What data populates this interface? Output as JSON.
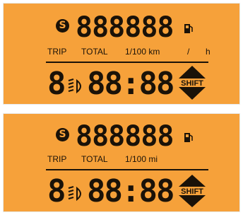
{
  "top_panel": {
    "service_icon": "wrench-service-icon",
    "service_glyph": "S",
    "odometer": "888888",
    "fuel_icon": "fuel-pump-icon",
    "trip": "TRIP",
    "total": "TOTAL",
    "units": "1/100 km",
    "slash": "/",
    "hour": "h",
    "gear": "8",
    "light_icon": "headlight-icon",
    "clock": "88:88",
    "shift": "SHIFT"
  },
  "bottom_panel": {
    "service_icon": "wrench-service-icon",
    "service_glyph": "S",
    "odometer": "888888",
    "fuel_icon": "fuel-pump-icon",
    "trip": "TRIP",
    "total": "TOTAL",
    "units": "1/100 mi",
    "gear": "8",
    "light_icon": "headlight-icon",
    "clock": "88:88",
    "shift": "SHIFT"
  },
  "colors": {
    "panel_bg": "#f6a13a",
    "segment": "#1a1208"
  }
}
